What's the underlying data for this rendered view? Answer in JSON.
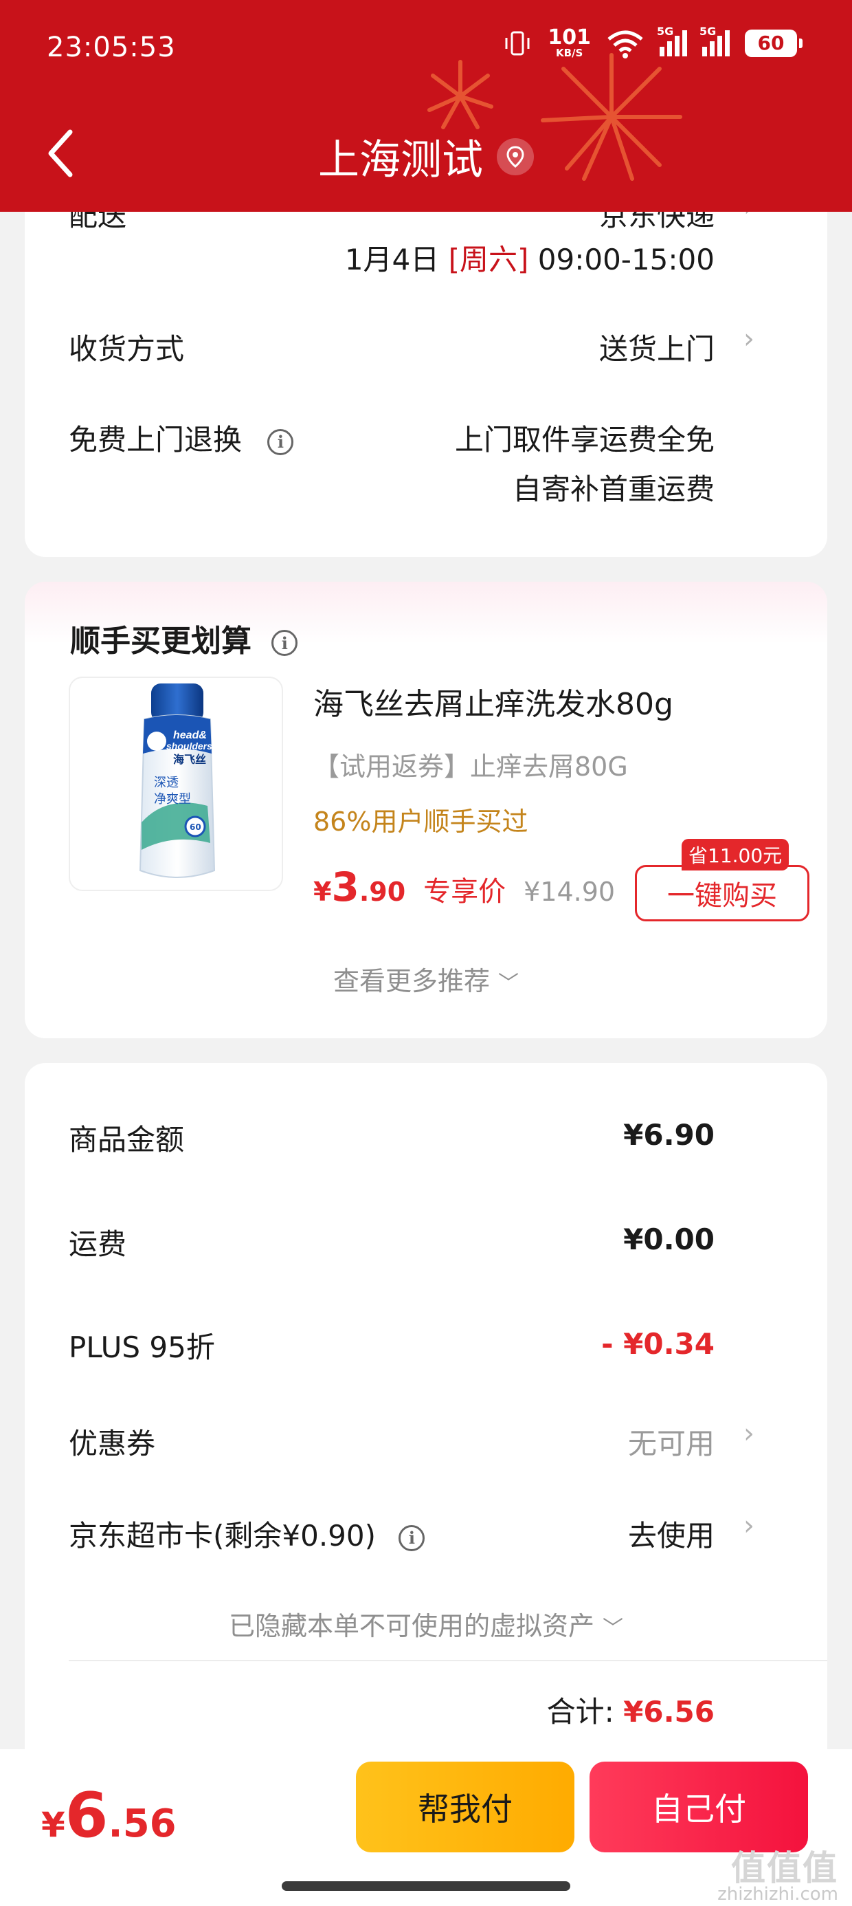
{
  "status_bar": {
    "time": "23:05:53",
    "net_speed_value": "101",
    "net_speed_unit": "KB/S",
    "signal_1_label": "5G",
    "signal_2_label": "5G",
    "battery": "60"
  },
  "header": {
    "title": "上海测试",
    "accent_color": "#c8121a"
  },
  "delivery": {
    "partial_label": "配送",
    "partial_value": "京东快递",
    "date": "1月4日",
    "weekday": "[周六]",
    "time_range": "09:00-15:00",
    "receive_label": "收货方式",
    "receive_value": "送货上门",
    "return_label": "免费上门退换",
    "return_value_1": "上门取件享运费全免",
    "return_value_2": "自寄补首重运费"
  },
  "recommend": {
    "title": "顺手买更划算",
    "product_name": "海飞丝去屑止痒洗发水80g",
    "product_sub": "【试用返券】止痒去屑80G",
    "buy_rate": "86%用户顺手买过",
    "price_currency": "¥",
    "price_int": "3",
    "price_dec": ".90",
    "exclusive_label": "专享价",
    "original_price": "¥14.90",
    "save_tag": "省11.00元",
    "buy_button": "一键购买",
    "more": "查看更多推荐",
    "image_text_1": "head&",
    "image_text_2": "shoulders",
    "image_text_3": "海飞丝",
    "image_text_4": "深透",
    "image_text_5": "净爽型",
    "image_text_6": "60"
  },
  "summary": {
    "goods_label": "商品金额",
    "goods_value": "¥6.90",
    "shipping_label": "运费",
    "shipping_value": "¥0.00",
    "plus_label": "PLUS 95折",
    "plus_value": "- ¥0.34",
    "coupon_label": "优惠券",
    "coupon_value": "无可用",
    "card_label": "京东超市卡(剩余¥0.90)",
    "card_value": "去使用",
    "hidden_assets": "已隐藏本单不可使用的虚拟资产",
    "total_label": "合计:",
    "total_value": "¥6.56"
  },
  "bottom": {
    "currency": "¥",
    "total_int": "6",
    "total_dec": ".56",
    "help_pay": "帮我付",
    "self_pay": "自己付"
  },
  "watermark": {
    "line1": "值值值",
    "line2": "zhizhizhi.com"
  }
}
